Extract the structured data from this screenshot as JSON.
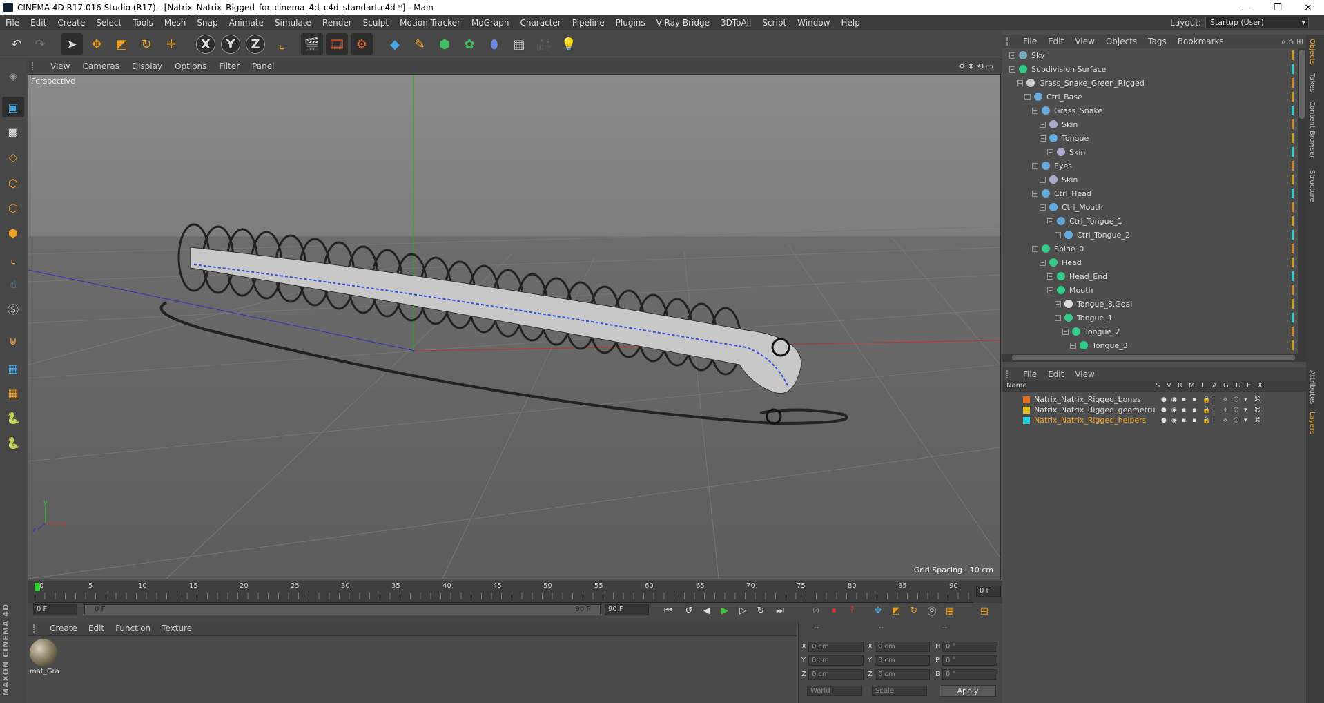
{
  "window": {
    "title": "CINEMA 4D R17.016 Studio (R17) - [Natrix_Natrix_Rigged_for_cinema_4d_c4d_standart.c4d *] - Main",
    "minimize": "—",
    "restore": "❐",
    "close": "✕"
  },
  "menubar": [
    "File",
    "Edit",
    "Create",
    "Select",
    "Tools",
    "Mesh",
    "Snap",
    "Animate",
    "Simulate",
    "Render",
    "Sculpt",
    "Motion Tracker",
    "MoGraph",
    "Character",
    "Pipeline",
    "Plugins",
    "V-Ray Bridge",
    "3DToAll",
    "Script",
    "Window",
    "Help"
  ],
  "layout": {
    "label": "Layout:",
    "value": "Startup (User)"
  },
  "toolbar": {
    "axis_x": "X",
    "axis_y": "Y",
    "axis_z": "Z"
  },
  "viewport": {
    "menu": [
      "View",
      "Cameras",
      "Display",
      "Options",
      "Filter",
      "Panel"
    ],
    "camera_label": "Perspective",
    "grid_spacing": "Grid Spacing : 10 cm",
    "axis_y": "y",
    "axis_x": "x",
    "axis_z": "z"
  },
  "timeline": {
    "ticks": [
      "0",
      "5",
      "10",
      "15",
      "20",
      "25",
      "30",
      "35",
      "40",
      "45",
      "50",
      "55",
      "60",
      "65",
      "70",
      "75",
      "80",
      "85",
      "90"
    ],
    "current_frame": "0 F",
    "start_field": "0 F",
    "range_start": "0 F",
    "range_end": "90 F",
    "end_field": "90 F"
  },
  "material_manager": {
    "menu": [
      "Create",
      "Edit",
      "Function",
      "Texture"
    ],
    "materials": [
      {
        "name": "mat_Gra"
      }
    ]
  },
  "coords": {
    "headers": [
      "--",
      "--",
      "--"
    ],
    "rows": [
      {
        "a": "X",
        "av": "0 cm",
        "b": "X",
        "bv": "0 cm",
        "c": "H",
        "cv": "0 °"
      },
      {
        "a": "Y",
        "av": "0 cm",
        "b": "Y",
        "bv": "0 cm",
        "c": "P",
        "cv": "0 °"
      },
      {
        "a": "Z",
        "av": "0 cm",
        "b": "Z",
        "bv": "0 cm",
        "c": "B",
        "cv": "0 °"
      }
    ],
    "space": "World",
    "mode": "Scale",
    "apply": "Apply"
  },
  "object_manager": {
    "menu": [
      "File",
      "Edit",
      "View",
      "Objects",
      "Tags",
      "Bookmarks"
    ],
    "items": [
      {
        "name": "Sky",
        "depth": 0
      },
      {
        "name": "Subdivision Surface",
        "depth": 0
      },
      {
        "name": "Grass_Snake_Green_Rigged",
        "depth": 1
      },
      {
        "name": "Ctrl_Base",
        "depth": 2
      },
      {
        "name": "Grass_Snake",
        "depth": 3
      },
      {
        "name": "Skin",
        "depth": 4
      },
      {
        "name": "Tongue",
        "depth": 4
      },
      {
        "name": "Skin",
        "depth": 5
      },
      {
        "name": "Eyes",
        "depth": 3
      },
      {
        "name": "Skin",
        "depth": 4
      },
      {
        "name": "Ctrl_Head",
        "depth": 3
      },
      {
        "name": "Ctrl_Mouth",
        "depth": 4
      },
      {
        "name": "Ctrl_Tongue_1",
        "depth": 5
      },
      {
        "name": "Ctrl_Tongue_2",
        "depth": 6
      },
      {
        "name": "Spine_0",
        "depth": 3
      },
      {
        "name": "Head",
        "depth": 4
      },
      {
        "name": "Head_End",
        "depth": 5
      },
      {
        "name": "Mouth",
        "depth": 5
      },
      {
        "name": "Tongue_8.Goal",
        "depth": 6
      },
      {
        "name": "Tongue_1",
        "depth": 6
      },
      {
        "name": "Tongue_2",
        "depth": 7
      },
      {
        "name": "Tongue_3",
        "depth": 8
      }
    ],
    "side_tabs": [
      "Objects",
      "Takes",
      "Content Browser",
      "Structure"
    ]
  },
  "layer_manager": {
    "menu": [
      "File",
      "Edit",
      "View"
    ],
    "columns": [
      "Name",
      "S",
      "V",
      "R",
      "M",
      "L",
      "A",
      "G",
      "D",
      "E",
      "X"
    ],
    "layers": [
      {
        "name": "Natrix_Natrix_Rigged_bones",
        "color": "#e07020"
      },
      {
        "name": "Natrix_Natrix_Rigged_geometru",
        "color": "#e0c020"
      },
      {
        "name": "Natrix_Natrix_Rigged_helpers",
        "color": "#20c8d8"
      }
    ],
    "side_tabs": [
      "Attributes",
      "Layers"
    ]
  },
  "brand": "MAXON CINEMA 4D"
}
